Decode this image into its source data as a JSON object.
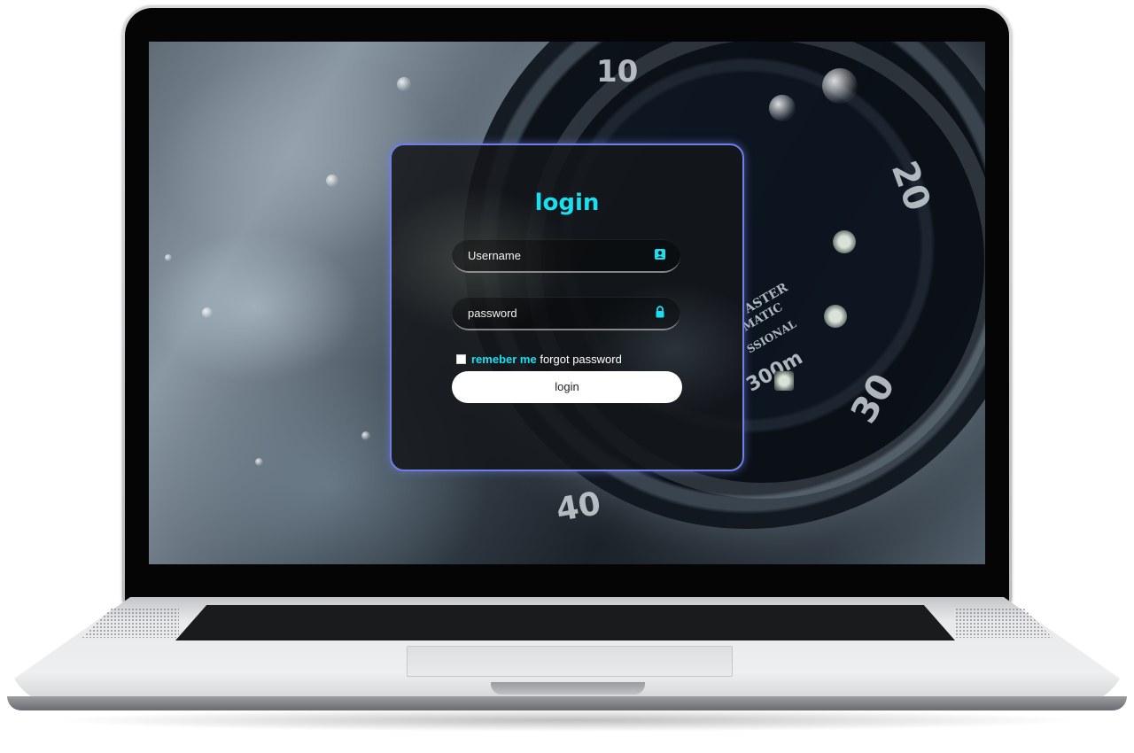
{
  "login_form": {
    "title": "login",
    "username_label": "Username",
    "username_icon": "person-badge-icon",
    "password_label": "password",
    "password_icon": "lock-icon",
    "remember_label": "remeber me",
    "forgot_label": "forgot password",
    "submit_label": "login",
    "accent_color": "#19e0f0",
    "border_color": "#6f7fe6"
  },
  "wallpaper": {
    "dial_labels": [
      "10",
      "20",
      "30",
      "40",
      "30"
    ],
    "dial_brand_lines": [
      "ASTER",
      "MATIC",
      "SSIONAL",
      "300m"
    ]
  }
}
